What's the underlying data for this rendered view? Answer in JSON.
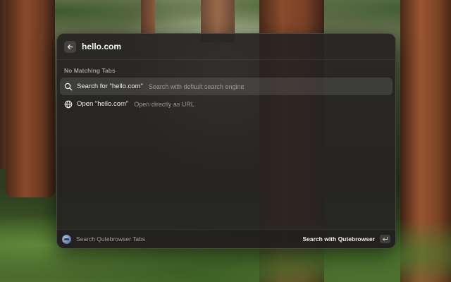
{
  "search": {
    "query": "hello.com",
    "back_icon": "arrow-left-icon"
  },
  "results": {
    "section_title": "No Matching Tabs",
    "items": [
      {
        "icon": "magnifying-glass-icon",
        "title": "Search for \"hello.com\"",
        "subtitle": "Search with default search engine",
        "selected": true
      },
      {
        "icon": "globe-icon",
        "title": "Open \"hello.com\"",
        "subtitle": "Open directly as URL",
        "selected": false
      }
    ]
  },
  "footer": {
    "app_icon": "qutebrowser-icon",
    "left_label": "Search Qutebrowser Tabs",
    "action_label": "Search with Qutebrowser",
    "action_key_icon": "return-key-icon"
  },
  "colors": {
    "panel": "#262422",
    "selected_row": "#3a3836",
    "text_primary": "#f0efed",
    "text_secondary": "#9c9a96"
  }
}
